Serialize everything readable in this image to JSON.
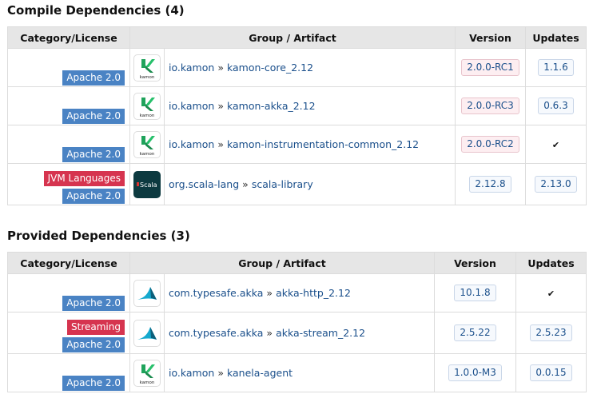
{
  "compile": {
    "title": "Compile Dependencies (4)",
    "headers": {
      "category": "Category/License",
      "artifact": "Group / Artifact",
      "version": "Version",
      "updates": "Updates"
    },
    "rows": [
      {
        "category": "",
        "license": "Apache 2.0",
        "logo": "kamon-logo-icon",
        "group": "io.kamon",
        "artifact": "kamon-core_2.12",
        "version": "2.0.0-RC1",
        "version_prerelease": true,
        "update": "1.1.6",
        "update_available": true
      },
      {
        "category": "",
        "license": "Apache 2.0",
        "logo": "kamon-logo-icon",
        "group": "io.kamon",
        "artifact": "kamon-akka_2.12",
        "version": "2.0.0-RC3",
        "version_prerelease": true,
        "update": "0.6.3",
        "update_available": true
      },
      {
        "category": "",
        "license": "Apache 2.0",
        "logo": "kamon-logo-icon",
        "group": "io.kamon",
        "artifact": "kamon-instrumentation-common_2.12",
        "version": "2.0.0-RC2",
        "version_prerelease": true,
        "update": "✔",
        "update_available": false
      },
      {
        "category": "JVM Languages",
        "license": "Apache 2.0",
        "logo": "scala-logo-icon",
        "group": "org.scala-lang",
        "artifact": "scala-library",
        "version": "2.12.8",
        "version_prerelease": false,
        "update": "2.13.0",
        "update_available": true
      }
    ]
  },
  "provided": {
    "title": "Provided Dependencies (3)",
    "headers": {
      "category": "Category/License",
      "artifact": "Group / Artifact",
      "version": "Version",
      "updates": "Updates"
    },
    "rows": [
      {
        "category": "",
        "license": "Apache 2.0",
        "logo": "akka-logo-icon",
        "group": "com.typesafe.akka",
        "artifact": "akka-http_2.12",
        "version": "10.1.8",
        "version_prerelease": false,
        "update": "✔",
        "update_available": false
      },
      {
        "category": "Streaming",
        "license": "Apache 2.0",
        "logo": "akka-logo-icon",
        "group": "com.typesafe.akka",
        "artifact": "akka-stream_2.12",
        "version": "2.5.22",
        "version_prerelease": false,
        "update": "2.5.23",
        "update_available": true
      },
      {
        "category": "",
        "license": "Apache 2.0",
        "logo": "kamon-logo-icon",
        "group": "io.kamon",
        "artifact": "kanela-agent",
        "version": "1.0.0-M3",
        "version_prerelease": false,
        "update": "0.0.15",
        "update_available": true
      }
    ]
  },
  "logo_text": {
    "kamon": "kamon",
    "scala": "Scala"
  },
  "colors": {
    "license_badge": "#4a83c4",
    "category_badge": "#d6344f",
    "link": "#1a4f8b",
    "header_bg": "#e6e6e6"
  }
}
